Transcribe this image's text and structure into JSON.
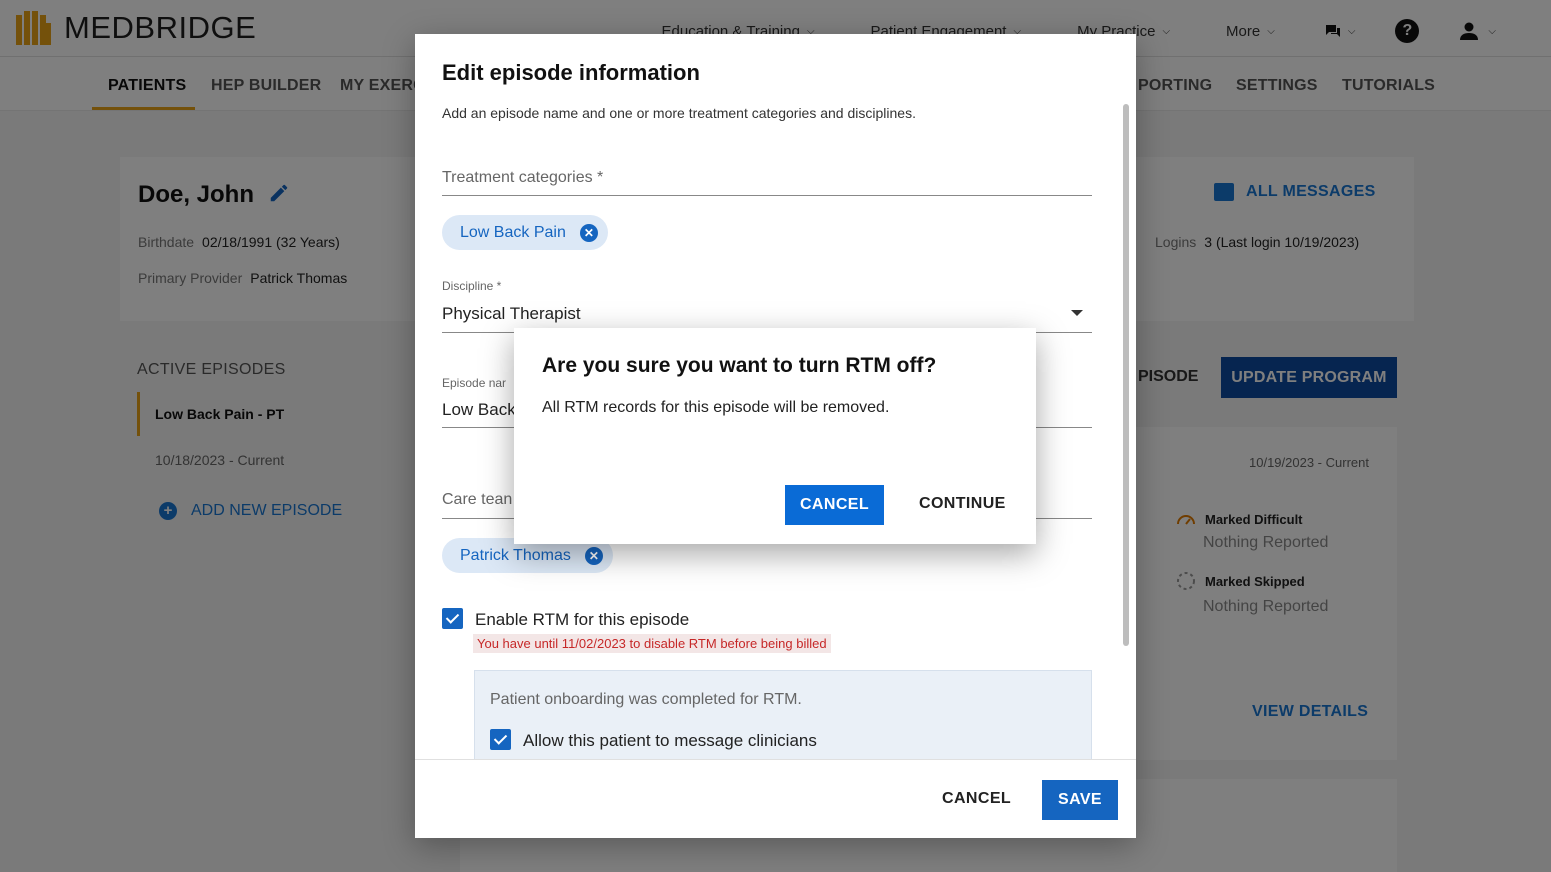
{
  "app": {
    "logo_text": "MEDBRIDGE",
    "colors": {
      "brand": "#e8a317",
      "primary": "#1565c0",
      "dark_primary": "#0d4ba0",
      "warning": "#c62828"
    }
  },
  "topnav": {
    "items": [
      {
        "label": "Education & Training"
      },
      {
        "label": "Patient Engagement"
      },
      {
        "label": "My Practice"
      },
      {
        "label": "More"
      }
    ],
    "chat_icon": "chat-icon",
    "help_icon": "help-icon",
    "user_icon": "user-icon"
  },
  "subnav": {
    "tabs": [
      {
        "label": "PATIENTS"
      },
      {
        "label": "HEP BUILDER"
      },
      {
        "label": "MY EXERC"
      },
      {
        "label": "PORTING"
      },
      {
        "label": "SETTINGS"
      },
      {
        "label": "TUTORIALS"
      }
    ]
  },
  "patient": {
    "name": "Doe, John",
    "birthdate_label": "Birthdate",
    "birthdate": "02/18/1991 (32 Years)",
    "provider_label": "Primary Provider",
    "provider": "Patrick Thomas",
    "logins_label": "Logins",
    "logins": "3 (Last login 10/19/2023)",
    "all_messages": "ALL MESSAGES"
  },
  "episodes": {
    "heading": "ACTIVE EPISODES",
    "active_name": "Low Back Pain - PT",
    "active_date": "10/18/2023 - Current",
    "add_label": "ADD NEW EPISODE"
  },
  "program": {
    "episode_btn_partial": "PISODE",
    "update_btn": "UPDATE PROGRAM",
    "date": "10/19/2023 - Current",
    "marked_difficult": "Marked Difficult",
    "marked_difficult_value": "Nothing Reported",
    "marked_skipped": "Marked Skipped",
    "marked_skipped_value": "Nothing Reported",
    "view_details": "VIEW DETAILS"
  },
  "edit_modal": {
    "title": "Edit episode information",
    "subtitle": "Add an episode name and one or more treatment categories and disciplines.",
    "treatment_placeholder": "Treatment categories *",
    "treatment_chip": "Low Back Pain",
    "discipline_label": "Discipline *",
    "discipline_value": "Physical Therapist",
    "episode_label_partial": "Episode nar",
    "episode_value_partial": "Low Back",
    "care_team_partial": "Care tean",
    "care_team_chip": "Patrick Thomas",
    "rtm_checkbox_label": "Enable RTM for this episode",
    "rtm_warning": "You have until 11/02/2023 to disable RTM before being billed",
    "rtm_onboarding": "Patient onboarding was completed for RTM.",
    "message_checkbox_label": "Allow this patient to message clinicians",
    "cancel": "CANCEL",
    "save": "SAVE"
  },
  "confirm_dialog": {
    "title": "Are you sure you want to turn RTM off?",
    "body": "All RTM records for this episode will be removed.",
    "cancel": "CANCEL",
    "continue": "CONTINUE"
  }
}
